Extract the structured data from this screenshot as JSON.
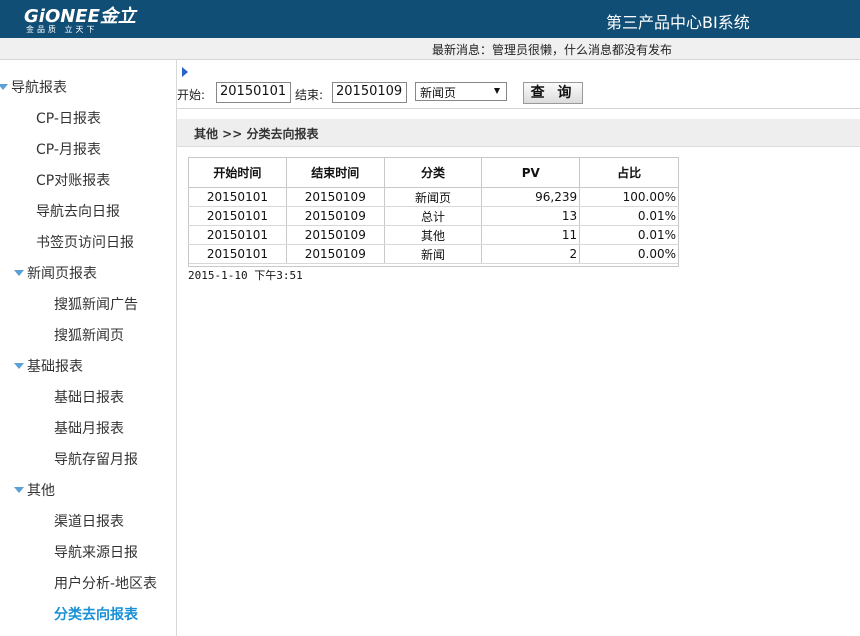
{
  "header": {
    "logo_text": "GiONEE金立",
    "logo_slogan": "金品质  立天下",
    "system_title": "第三产品中心BI系统",
    "notice": "最新消息：管理员很懒，什么消息都没有发布"
  },
  "sidebar": {
    "items": [
      {
        "label": "导航报表",
        "group": true
      },
      {
        "label": "CP-日报表"
      },
      {
        "label": "CP-月报表"
      },
      {
        "label": "CP对账报表"
      },
      {
        "label": "导航去向日报"
      },
      {
        "label": "书签页访问日报"
      },
      {
        "label": "新闻页报表",
        "group": true
      },
      {
        "label": "搜狐新闻广告"
      },
      {
        "label": "搜狐新闻页"
      },
      {
        "label": "基础报表",
        "group": true
      },
      {
        "label": "基础日报表"
      },
      {
        "label": "基础月报表"
      },
      {
        "label": "导航存留月报"
      },
      {
        "label": "其他",
        "group": true
      },
      {
        "label": "渠道日报表"
      },
      {
        "label": "导航来源日报"
      },
      {
        "label": "用户分析-地区表"
      },
      {
        "label": "分类去向报表",
        "active": true
      }
    ]
  },
  "filter": {
    "start_label": "开始:",
    "start_value": "20150101",
    "end_label": "结束:",
    "end_value": "20150109",
    "select_value": "新闻页",
    "query_label": "查 询"
  },
  "breadcrumb": "其他 >> 分类去向报表",
  "table": {
    "headers": [
      "开始时间",
      "结束时间",
      "分类",
      "PV",
      "占比"
    ],
    "rows": [
      [
        "20150101",
        "20150109",
        "新闻页",
        "96,239",
        "100.00%"
      ],
      [
        "20150101",
        "20150109",
        "总计",
        "13",
        "0.01%"
      ],
      [
        "20150101",
        "20150109",
        "其他",
        "11",
        "0.01%"
      ],
      [
        "20150101",
        "20150109",
        "新闻",
        "2",
        "0.00%"
      ]
    ]
  },
  "timestamp": "2015-1-10 下午3:51"
}
